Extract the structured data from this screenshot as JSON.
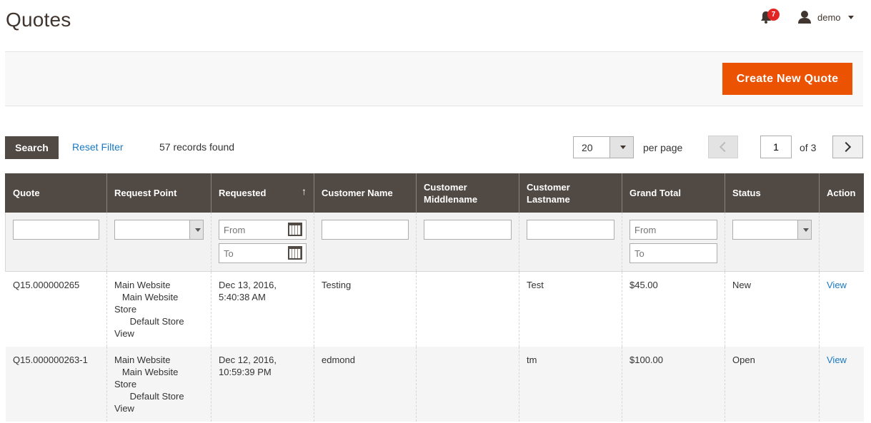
{
  "header": {
    "title": "Quotes",
    "notification_count": "7",
    "user_name": "demo"
  },
  "actions": {
    "create_label": "Create New Quote"
  },
  "toolbar": {
    "search_label": "Search",
    "reset_label": "Reset Filter",
    "records_found": "57 records found",
    "per_page_value": "20",
    "per_page_label": "per page",
    "current_page": "1",
    "page_total": "of 3"
  },
  "grid": {
    "columns": [
      "Quote",
      "Request Point",
      "Requested",
      "Customer Name",
      "Customer Middlename",
      "Customer Lastname",
      "Grand Total",
      "Status",
      "Action"
    ],
    "filters": {
      "from_placeholder": "From",
      "to_placeholder": "To"
    },
    "rows": [
      {
        "quote": "Q15.000000265",
        "request_point": [
          "Main Website",
          "   Main Website",
          "Store",
          "      Default Store",
          "View"
        ],
        "requested": [
          "Dec 13, 2016,",
          "5:40:38 AM"
        ],
        "customer_name": "Testing",
        "customer_middlename": "",
        "customer_lastname": "Test",
        "grand_total": "$45.00",
        "status": "New",
        "action": "View"
      },
      {
        "quote": "Q15.000000263-1",
        "request_point": [
          "Main Website",
          "   Main Website",
          "Store",
          "      Default Store",
          "View"
        ],
        "requested": [
          "Dec 12, 2016,",
          "10:59:39 PM"
        ],
        "customer_name": "edmond",
        "customer_middlename": "",
        "customer_lastname": "tm",
        "grand_total": "$100.00",
        "status": "Open",
        "action": "View"
      }
    ]
  },
  "colors": {
    "accent": "#eb5202",
    "header_bg": "#514943",
    "link": "#1979c3",
    "badge": "#e22626"
  },
  "icons": [
    "bell-icon",
    "user-icon",
    "calendar-icon",
    "chevron-left-icon",
    "chevron-right-icon",
    "sort-up-icon"
  ]
}
